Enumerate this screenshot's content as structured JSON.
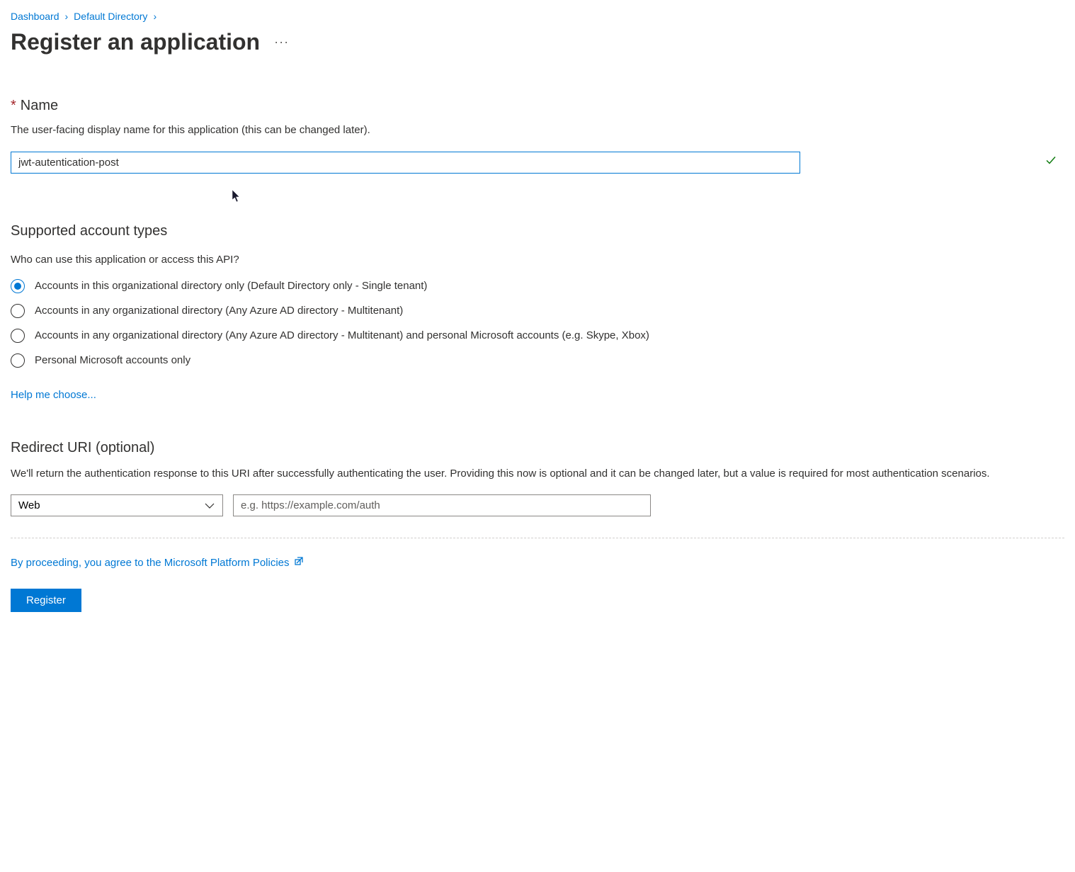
{
  "breadcrumb": {
    "items": [
      "Dashboard",
      "Default Directory"
    ],
    "separator": "›"
  },
  "page": {
    "title": "Register an application",
    "more_label": "···"
  },
  "name_section": {
    "required_mark": "*",
    "label": "Name",
    "description": "The user-facing display name for this application (this can be changed later).",
    "value": "jwt-autentication-post"
  },
  "account_types": {
    "heading": "Supported account types",
    "question": "Who can use this application or access this API?",
    "options": [
      {
        "label": "Accounts in this organizational directory only (Default Directory only - Single tenant)",
        "selected": true
      },
      {
        "label": "Accounts in any organizational directory (Any Azure AD directory - Multitenant)",
        "selected": false
      },
      {
        "label": "Accounts in any organizational directory (Any Azure AD directory - Multitenant) and personal Microsoft accounts (e.g. Skype, Xbox)",
        "selected": false
      },
      {
        "label": "Personal Microsoft accounts only",
        "selected": false
      }
    ],
    "help_link": "Help me choose..."
  },
  "redirect_uri": {
    "heading": "Redirect URI (optional)",
    "description": "We'll return the authentication response to this URI after successfully authenticating the user. Providing this now is optional and it can be changed later, but a value is required for most authentication scenarios.",
    "platform_value": "Web",
    "uri_placeholder": "e.g. https://example.com/auth"
  },
  "footer": {
    "policies_text": "By proceeding, you agree to the Microsoft Platform Policies",
    "register_label": "Register"
  }
}
